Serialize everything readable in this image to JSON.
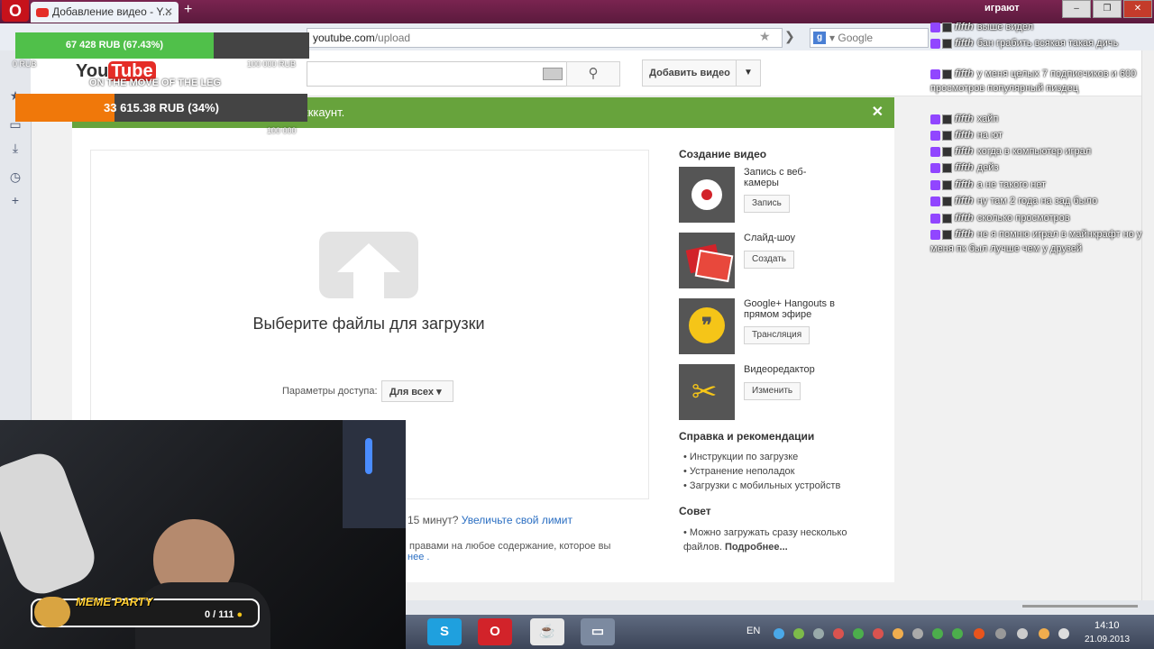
{
  "browser": {
    "tab_title": "Добавление видео - Y...",
    "tab_close": "✕",
    "new_tab": "+",
    "url_host": "youtube.com",
    "url_path": "/upload",
    "search_engine": "Google",
    "window_controls": [
      "–",
      "❐",
      "✕"
    ]
  },
  "youtube": {
    "logo_you": "You",
    "logo_tube": "Tube",
    "add_video_label": "Добавить видео",
    "add_video_caret": "▼",
    "banner_text": "кккаунт.",
    "banner_close": "✕",
    "upload_title": "Выберите файлы для загрузки",
    "access_label": "Параметры доступа:",
    "access_value": "Для всех",
    "limit_prefix": "15 минут?",
    "limit_link": "Увеличьте свой лимит",
    "rights_text": "правами на любое содержание, которое вы",
    "rights_link": "нее ."
  },
  "right_column": {
    "create_heading": "Создание видео",
    "tools": [
      {
        "label": "Запись с веб-камеры",
        "button": "Запись",
        "icon": "record-icon"
      },
      {
        "label": "Слайд-шоу",
        "button": "Создать",
        "icon": "slideshow-icon"
      },
      {
        "label": "Google+ Hangouts в прямом эфире",
        "button": "Трансляция",
        "icon": "hangouts-icon"
      },
      {
        "label": "Видеоредактор",
        "button": "Изменить",
        "icon": "scissors-icon"
      }
    ],
    "help_heading": "Справка и рекомендации",
    "help_items": [
      "Инструкции по загрузке",
      "Устранение неполадок",
      "Загрузки с мобильных устройств"
    ],
    "tip_heading": "Совет",
    "tip_text": "Можно загружать сразу несколько файлов.",
    "tip_link": "Подробнее..."
  },
  "overlay": {
    "donation_goal_1": {
      "text": "67 428 RUB (67.43%)",
      "progress": 0.6743,
      "color": "#50c04a"
    },
    "donation_goal_2": {
      "text": "33 615.38 RUB (34%)",
      "progress": 0.34,
      "color": "#f0780a"
    },
    "goal_small_1": "0 RUB",
    "goal_small_2": "100 000 RUB",
    "goal_small_3": "100 000",
    "legend": "ON THE MOVE OF THE LEG",
    "meme_title": "MEME PARTY",
    "meme_count": "0 / 111"
  },
  "chat": {
    "header": "играют",
    "messages": [
      {
        "nick": "fifth",
        "text": "выше видел"
      },
      {
        "nick": "fifth",
        "text": "бан грабить всякая такая дичь"
      },
      {
        "nick": "fifth",
        "text": "у меня целых 7 подписчиков и 600 просмотров популярный пиздец"
      },
      {
        "nick": "fifth",
        "text": "хайп"
      },
      {
        "nick": "fifth",
        "text": "на ют"
      },
      {
        "nick": "fifth",
        "text": "когда в компьютер играл"
      },
      {
        "nick": "fifth",
        "text": "дейз"
      },
      {
        "nick": "fifth",
        "text": "а не такого нет"
      },
      {
        "nick": "fifth",
        "text": "ну там 2 года на зад было"
      },
      {
        "nick": "fifth",
        "text": "сколько просмотров"
      },
      {
        "nick": "fifth",
        "text": "не я помню играл в майнкрафт но у меня пк был лучше чем у друзей"
      }
    ]
  },
  "taskbar": {
    "lang": "EN",
    "time": "14:10",
    "date": "21.09.2013"
  }
}
